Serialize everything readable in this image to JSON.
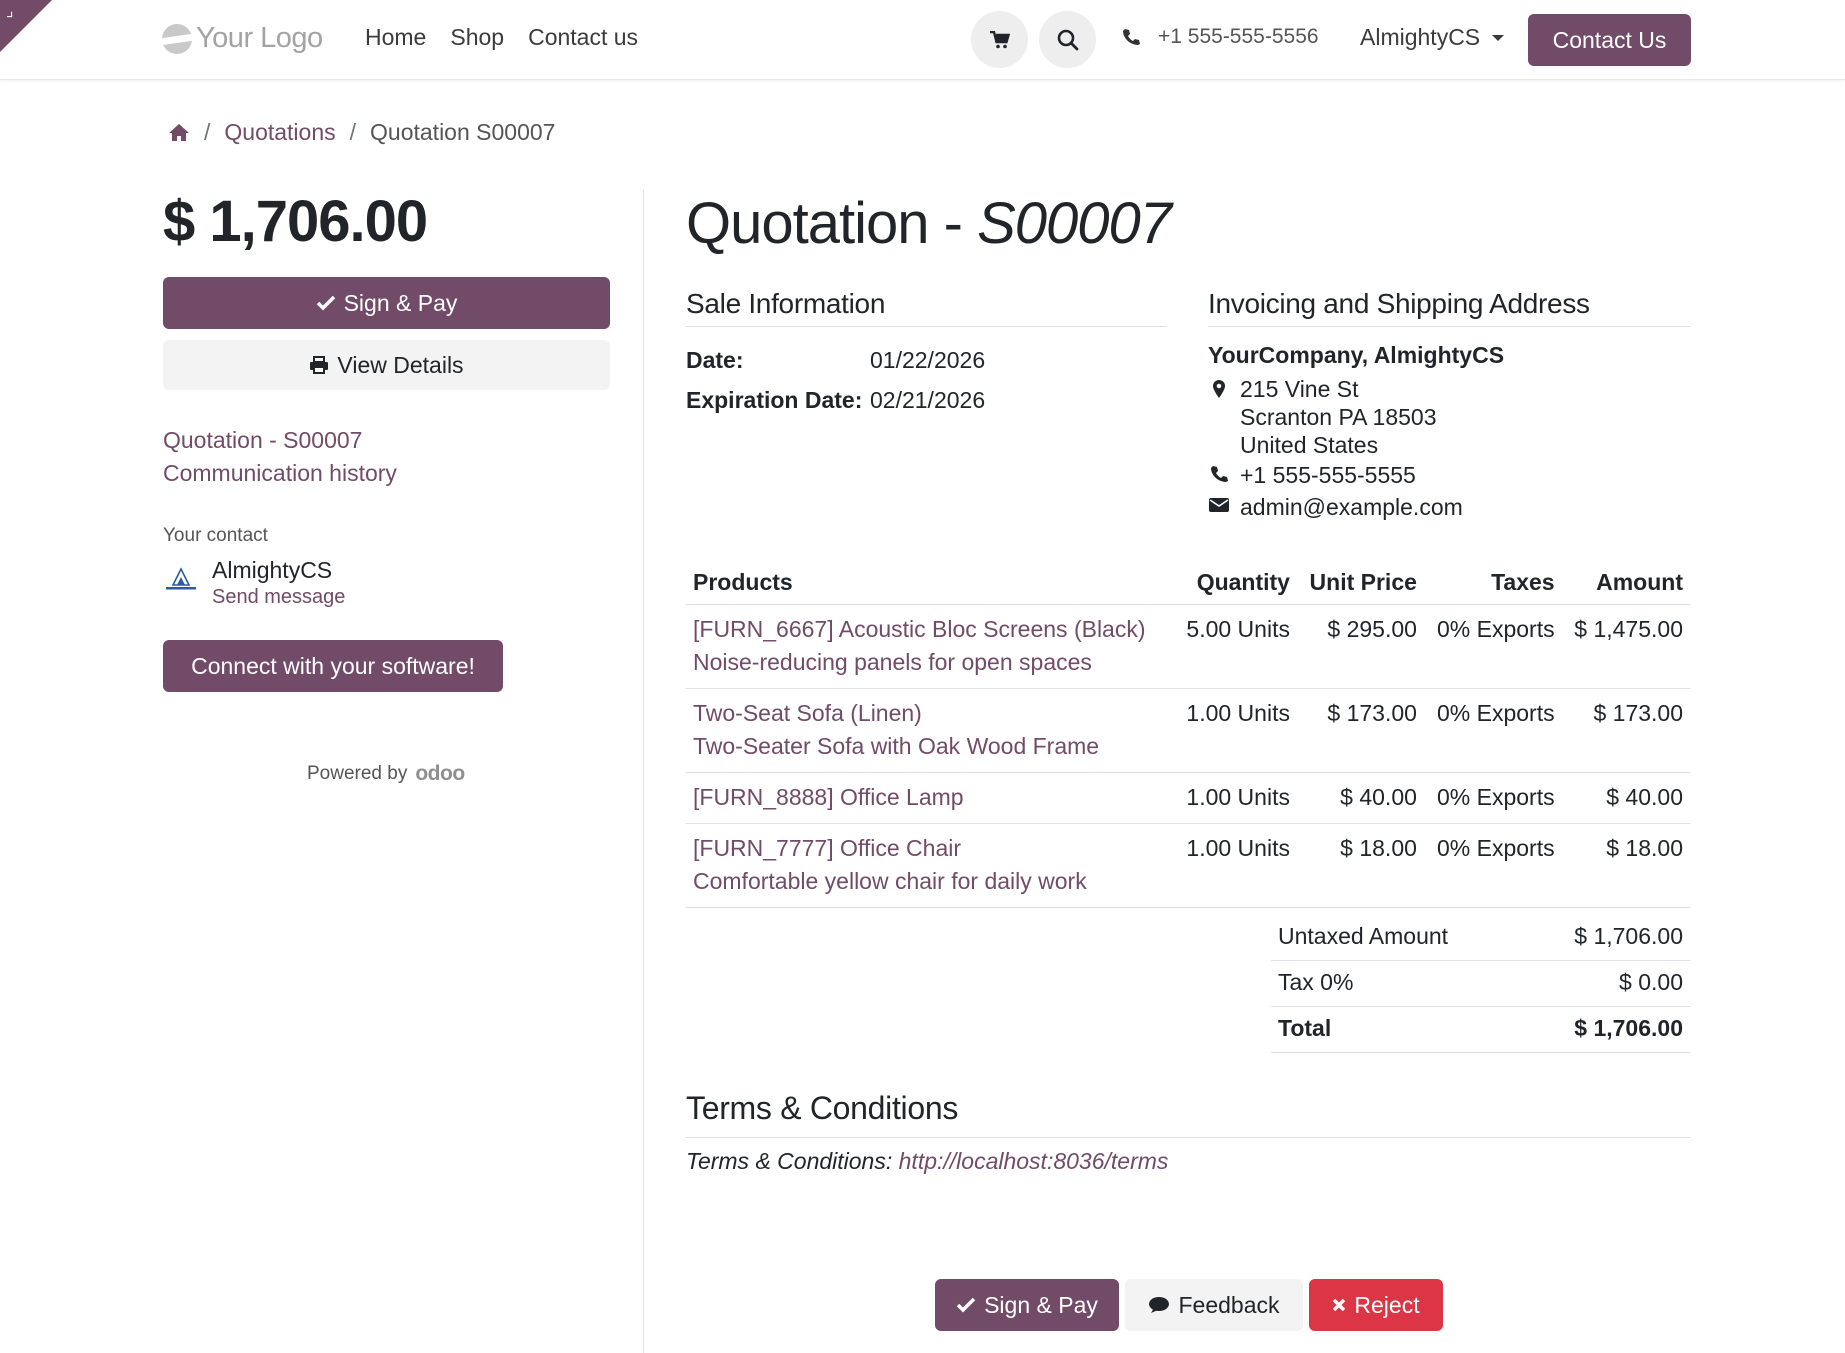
{
  "colors": {
    "brand": "#714b67",
    "danger": "#dc3545",
    "muted_bg": "#f3f3f3"
  },
  "header": {
    "logo_text": "Your Logo",
    "nav": [
      "Home",
      "Shop",
      "Contact us"
    ],
    "phone": "+1 555-555-5556",
    "user": "AlmightyCS",
    "contact_button": "Contact Us"
  },
  "breadcrumb": {
    "link": "Quotations",
    "current": "Quotation S00007"
  },
  "sidebar": {
    "amount": "$ 1,706.00",
    "sign_pay": "Sign & Pay",
    "view_details": "View Details",
    "links": [
      "Quotation - S00007",
      "Communication history"
    ],
    "contact_label": "Your contact",
    "contact_name": "AlmightyCS",
    "send_message": "Send message",
    "connect_button": "Connect with your software!",
    "powered_by": "Powered by",
    "odoo": "odoo"
  },
  "main": {
    "title_prefix": "Quotation - ",
    "title_ref": "S00007",
    "sale_info": {
      "heading": "Sale Information",
      "date_label": "Date:",
      "date": "01/22/2026",
      "exp_label": "Expiration Date:",
      "exp_date": "02/21/2026"
    },
    "address": {
      "heading": "Invoicing and Shipping Address",
      "name": "YourCompany, AlmightyCS",
      "street": "215 Vine St",
      "city": "Scranton PA 18503",
      "country": "United States",
      "phone": "+1 555-555-5555",
      "email": "admin@example.com"
    },
    "table": {
      "headers": [
        "Products",
        "Quantity",
        "Unit Price",
        "Taxes",
        "Amount"
      ],
      "rows": [
        {
          "name": "[FURN_6667] Acoustic Bloc Screens (Black)",
          "desc": "Noise-reducing panels for open spaces",
          "qty": "5.00 Units",
          "price": "$ 295.00",
          "taxes": "0% Exports",
          "amount": "$ 1,475.00"
        },
        {
          "name": "Two-Seat Sofa (Linen)",
          "desc": "Two-Seater Sofa with Oak Wood Frame",
          "qty": "1.00 Units",
          "price": "$ 173.00",
          "taxes": "0% Exports",
          "amount": "$ 173.00"
        },
        {
          "name": "[FURN_8888] Office Lamp",
          "desc": "",
          "qty": "1.00 Units",
          "price": "$ 40.00",
          "taxes": "0% Exports",
          "amount": "$ 40.00"
        },
        {
          "name": "[FURN_7777] Office Chair",
          "desc": "Comfortable yellow chair for daily work",
          "qty": "1.00 Units",
          "price": "$ 18.00",
          "taxes": "0% Exports",
          "amount": "$ 18.00"
        }
      ]
    },
    "totals": {
      "untaxed_label": "Untaxed Amount",
      "untaxed": "$ 1,706.00",
      "tax_label": "Tax 0%",
      "tax": "$ 0.00",
      "total_label": "Total",
      "total": "$ 1,706.00"
    },
    "terms": {
      "heading": "Terms & Conditions",
      "label": "Terms & Conditions: ",
      "link": "http://localhost:8036/terms"
    },
    "actions": {
      "sign_pay": "Sign & Pay",
      "feedback": "Feedback",
      "reject": "Reject"
    }
  }
}
